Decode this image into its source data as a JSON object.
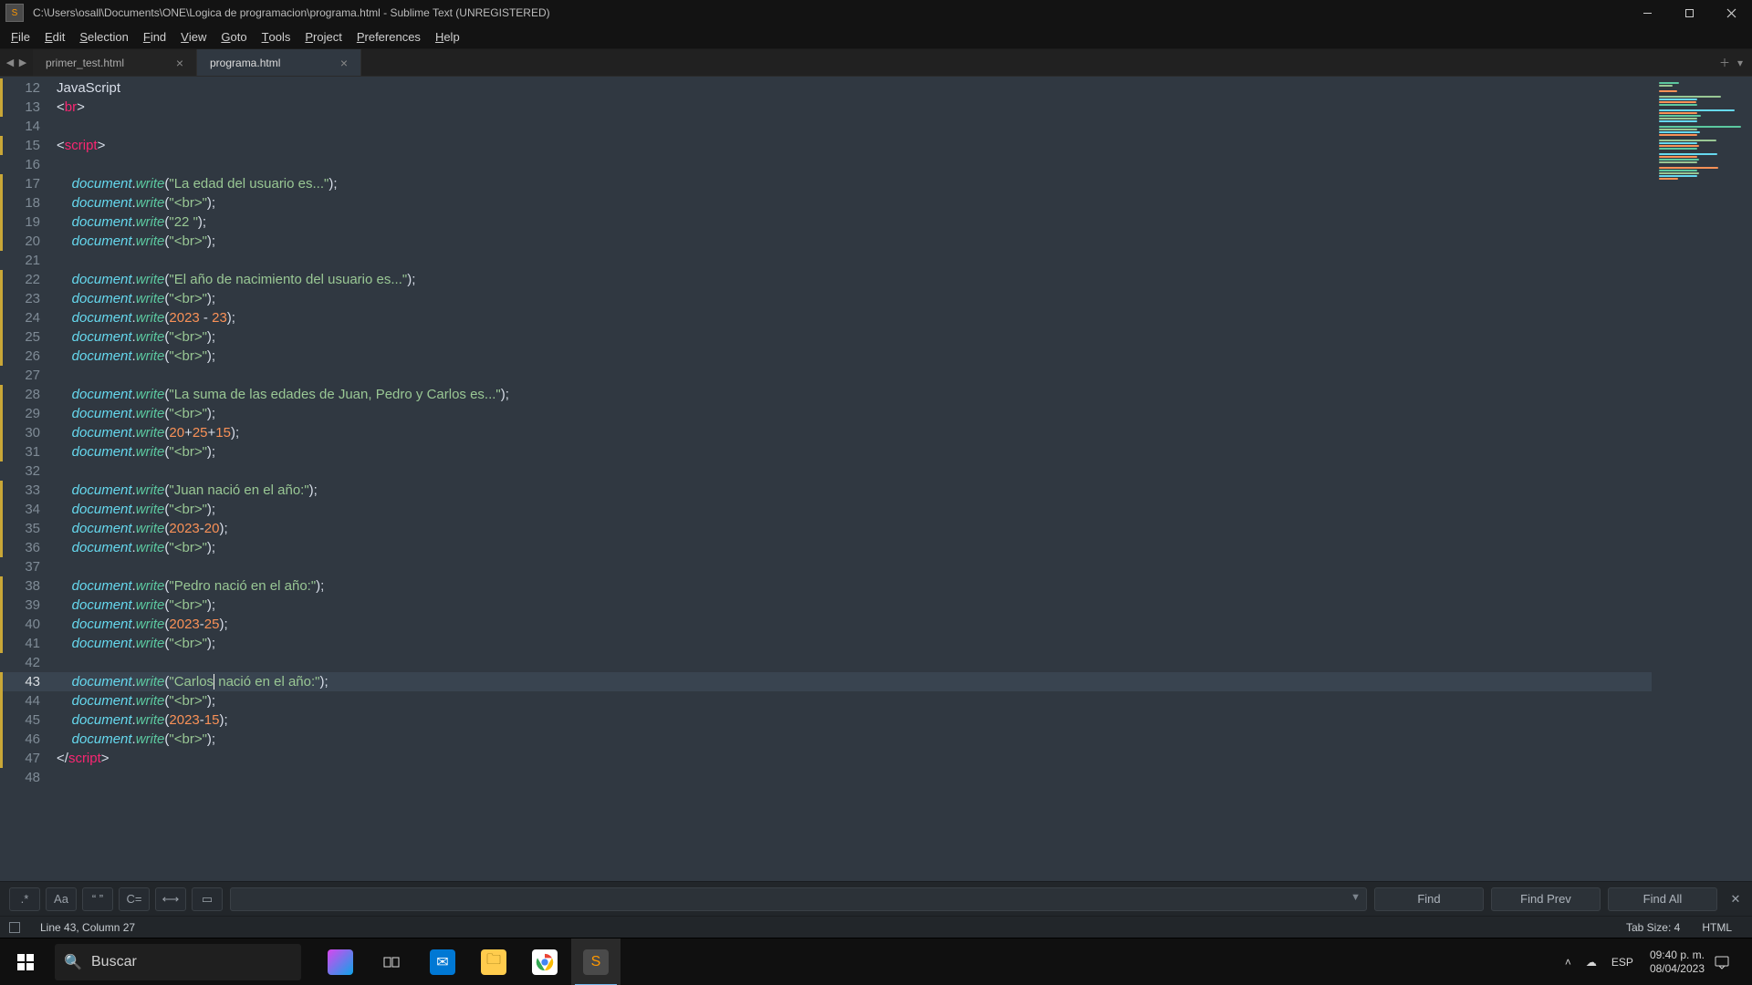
{
  "titlebar": {
    "path": "C:\\Users\\osall\\Documents\\ONE\\Logica de programacion\\programa.html - Sublime Text (UNREGISTERED)"
  },
  "menu": [
    "File",
    "Edit",
    "Selection",
    "Find",
    "View",
    "Goto",
    "Tools",
    "Project",
    "Preferences",
    "Help"
  ],
  "tabs": {
    "nav_back": "◀",
    "nav_fwd": "▶",
    "items": [
      {
        "label": "primer_test.html",
        "active": false
      },
      {
        "label": "programa.html",
        "active": true
      }
    ],
    "add": "＋",
    "more": "▾"
  },
  "editor": {
    "first_line_no": 12,
    "current_line_index": 31,
    "lines": [
      {
        "mod": true,
        "segs": [
          {
            "t": "plain",
            "v": "JavaScript"
          }
        ]
      },
      {
        "mod": true,
        "segs": [
          {
            "t": "punc",
            "v": "<"
          },
          {
            "t": "key",
            "v": "br"
          },
          {
            "t": "punc",
            "v": ">"
          }
        ]
      },
      {
        "mod": false,
        "segs": []
      },
      {
        "mod": true,
        "segs": [
          {
            "t": "punc",
            "v": "<"
          },
          {
            "t": "key",
            "v": "script"
          },
          {
            "t": "punc",
            "v": ">"
          }
        ]
      },
      {
        "mod": false,
        "segs": []
      },
      {
        "mod": true,
        "segs": [
          {
            "t": "plain",
            "v": "    "
          },
          {
            "t": "var",
            "v": "document"
          },
          {
            "t": "punc",
            "v": "."
          },
          {
            "t": "call",
            "v": "write"
          },
          {
            "t": "punc",
            "v": "("
          },
          {
            "t": "str",
            "v": "\"La edad del usuario es...\""
          },
          {
            "t": "punc",
            "v": ");"
          }
        ]
      },
      {
        "mod": true,
        "segs": [
          {
            "t": "plain",
            "v": "    "
          },
          {
            "t": "var",
            "v": "document"
          },
          {
            "t": "punc",
            "v": "."
          },
          {
            "t": "call",
            "v": "write"
          },
          {
            "t": "punc",
            "v": "("
          },
          {
            "t": "str",
            "v": "\"<br>\""
          },
          {
            "t": "punc",
            "v": ");"
          }
        ]
      },
      {
        "mod": true,
        "segs": [
          {
            "t": "plain",
            "v": "    "
          },
          {
            "t": "var",
            "v": "document"
          },
          {
            "t": "punc",
            "v": "."
          },
          {
            "t": "call",
            "v": "write"
          },
          {
            "t": "punc",
            "v": "("
          },
          {
            "t": "str",
            "v": "\"22 \""
          },
          {
            "t": "punc",
            "v": ");"
          }
        ]
      },
      {
        "mod": true,
        "segs": [
          {
            "t": "plain",
            "v": "    "
          },
          {
            "t": "var",
            "v": "document"
          },
          {
            "t": "punc",
            "v": "."
          },
          {
            "t": "call",
            "v": "write"
          },
          {
            "t": "punc",
            "v": "("
          },
          {
            "t": "str",
            "v": "\"<br>\""
          },
          {
            "t": "punc",
            "v": ");"
          }
        ]
      },
      {
        "mod": false,
        "segs": []
      },
      {
        "mod": true,
        "segs": [
          {
            "t": "plain",
            "v": "    "
          },
          {
            "t": "var",
            "v": "document"
          },
          {
            "t": "punc",
            "v": "."
          },
          {
            "t": "call",
            "v": "write"
          },
          {
            "t": "punc",
            "v": "("
          },
          {
            "t": "str",
            "v": "\"El año de nacimiento del usuario es...\""
          },
          {
            "t": "punc",
            "v": ");"
          }
        ]
      },
      {
        "mod": true,
        "segs": [
          {
            "t": "plain",
            "v": "    "
          },
          {
            "t": "var",
            "v": "document"
          },
          {
            "t": "punc",
            "v": "."
          },
          {
            "t": "call",
            "v": "write"
          },
          {
            "t": "punc",
            "v": "("
          },
          {
            "t": "str",
            "v": "\"<br>\""
          },
          {
            "t": "punc",
            "v": ");"
          }
        ]
      },
      {
        "mod": true,
        "segs": [
          {
            "t": "plain",
            "v": "    "
          },
          {
            "t": "var",
            "v": "document"
          },
          {
            "t": "punc",
            "v": "."
          },
          {
            "t": "call",
            "v": "write"
          },
          {
            "t": "punc",
            "v": "("
          },
          {
            "t": "num",
            "v": "2023"
          },
          {
            "t": "punc",
            "v": " - "
          },
          {
            "t": "num",
            "v": "23"
          },
          {
            "t": "punc",
            "v": ");"
          }
        ]
      },
      {
        "mod": true,
        "segs": [
          {
            "t": "plain",
            "v": "    "
          },
          {
            "t": "var",
            "v": "document"
          },
          {
            "t": "punc",
            "v": "."
          },
          {
            "t": "call",
            "v": "write"
          },
          {
            "t": "punc",
            "v": "("
          },
          {
            "t": "str",
            "v": "\"<br>\""
          },
          {
            "t": "punc",
            "v": ");"
          }
        ]
      },
      {
        "mod": true,
        "segs": [
          {
            "t": "plain",
            "v": "    "
          },
          {
            "t": "var",
            "v": "document"
          },
          {
            "t": "punc",
            "v": "."
          },
          {
            "t": "call",
            "v": "write"
          },
          {
            "t": "punc",
            "v": "("
          },
          {
            "t": "str",
            "v": "\"<br>\""
          },
          {
            "t": "punc",
            "v": ");"
          }
        ]
      },
      {
        "mod": false,
        "segs": []
      },
      {
        "mod": true,
        "segs": [
          {
            "t": "plain",
            "v": "    "
          },
          {
            "t": "var",
            "v": "document"
          },
          {
            "t": "punc",
            "v": "."
          },
          {
            "t": "call",
            "v": "write"
          },
          {
            "t": "punc",
            "v": "("
          },
          {
            "t": "str",
            "v": "\"La suma de las edades de Juan, Pedro y Carlos es...\""
          },
          {
            "t": "punc",
            "v": ");"
          }
        ]
      },
      {
        "mod": true,
        "segs": [
          {
            "t": "plain",
            "v": "    "
          },
          {
            "t": "var",
            "v": "document"
          },
          {
            "t": "punc",
            "v": "."
          },
          {
            "t": "call",
            "v": "write"
          },
          {
            "t": "punc",
            "v": "("
          },
          {
            "t": "str",
            "v": "\"<br>\""
          },
          {
            "t": "punc",
            "v": ");"
          }
        ]
      },
      {
        "mod": true,
        "segs": [
          {
            "t": "plain",
            "v": "    "
          },
          {
            "t": "var",
            "v": "document"
          },
          {
            "t": "punc",
            "v": "."
          },
          {
            "t": "call",
            "v": "write"
          },
          {
            "t": "punc",
            "v": "("
          },
          {
            "t": "num",
            "v": "20"
          },
          {
            "t": "punc",
            "v": "+"
          },
          {
            "t": "num",
            "v": "25"
          },
          {
            "t": "punc",
            "v": "+"
          },
          {
            "t": "num",
            "v": "15"
          },
          {
            "t": "punc",
            "v": ");"
          }
        ]
      },
      {
        "mod": true,
        "segs": [
          {
            "t": "plain",
            "v": "    "
          },
          {
            "t": "var",
            "v": "document"
          },
          {
            "t": "punc",
            "v": "."
          },
          {
            "t": "call",
            "v": "write"
          },
          {
            "t": "punc",
            "v": "("
          },
          {
            "t": "str",
            "v": "\"<br>\""
          },
          {
            "t": "punc",
            "v": ");"
          }
        ]
      },
      {
        "mod": false,
        "segs": []
      },
      {
        "mod": true,
        "segs": [
          {
            "t": "plain",
            "v": "    "
          },
          {
            "t": "var",
            "v": "document"
          },
          {
            "t": "punc",
            "v": "."
          },
          {
            "t": "call",
            "v": "write"
          },
          {
            "t": "punc",
            "v": "("
          },
          {
            "t": "str",
            "v": "\"Juan nació en el año:\""
          },
          {
            "t": "punc",
            "v": ");"
          }
        ]
      },
      {
        "mod": true,
        "segs": [
          {
            "t": "plain",
            "v": "    "
          },
          {
            "t": "var",
            "v": "document"
          },
          {
            "t": "punc",
            "v": "."
          },
          {
            "t": "call",
            "v": "write"
          },
          {
            "t": "punc",
            "v": "("
          },
          {
            "t": "str",
            "v": "\"<br>\""
          },
          {
            "t": "punc",
            "v": ");"
          }
        ]
      },
      {
        "mod": true,
        "segs": [
          {
            "t": "plain",
            "v": "    "
          },
          {
            "t": "var",
            "v": "document"
          },
          {
            "t": "punc",
            "v": "."
          },
          {
            "t": "call",
            "v": "write"
          },
          {
            "t": "punc",
            "v": "("
          },
          {
            "t": "num",
            "v": "2023"
          },
          {
            "t": "punc",
            "v": "-"
          },
          {
            "t": "num",
            "v": "20"
          },
          {
            "t": "punc",
            "v": ");"
          }
        ]
      },
      {
        "mod": true,
        "segs": [
          {
            "t": "plain",
            "v": "    "
          },
          {
            "t": "var",
            "v": "document"
          },
          {
            "t": "punc",
            "v": "."
          },
          {
            "t": "call",
            "v": "write"
          },
          {
            "t": "punc",
            "v": "("
          },
          {
            "t": "str",
            "v": "\"<br>\""
          },
          {
            "t": "punc",
            "v": ");"
          }
        ]
      },
      {
        "mod": false,
        "segs": []
      },
      {
        "mod": true,
        "segs": [
          {
            "t": "plain",
            "v": "    "
          },
          {
            "t": "var",
            "v": "document"
          },
          {
            "t": "punc",
            "v": "."
          },
          {
            "t": "call",
            "v": "write"
          },
          {
            "t": "punc",
            "v": "("
          },
          {
            "t": "str",
            "v": "\"Pedro nació en el año:\""
          },
          {
            "t": "punc",
            "v": ");"
          }
        ]
      },
      {
        "mod": true,
        "segs": [
          {
            "t": "plain",
            "v": "    "
          },
          {
            "t": "var",
            "v": "document"
          },
          {
            "t": "punc",
            "v": "."
          },
          {
            "t": "call",
            "v": "write"
          },
          {
            "t": "punc",
            "v": "("
          },
          {
            "t": "str",
            "v": "\"<br>\""
          },
          {
            "t": "punc",
            "v": ");"
          }
        ]
      },
      {
        "mod": true,
        "segs": [
          {
            "t": "plain",
            "v": "    "
          },
          {
            "t": "var",
            "v": "document"
          },
          {
            "t": "punc",
            "v": "."
          },
          {
            "t": "call",
            "v": "write"
          },
          {
            "t": "punc",
            "v": "("
          },
          {
            "t": "num",
            "v": "2023"
          },
          {
            "t": "punc",
            "v": "-"
          },
          {
            "t": "num",
            "v": "25"
          },
          {
            "t": "punc",
            "v": ");"
          }
        ]
      },
      {
        "mod": true,
        "segs": [
          {
            "t": "plain",
            "v": "    "
          },
          {
            "t": "var",
            "v": "document"
          },
          {
            "t": "punc",
            "v": "."
          },
          {
            "t": "call",
            "v": "write"
          },
          {
            "t": "punc",
            "v": "("
          },
          {
            "t": "str",
            "v": "\"<br>\""
          },
          {
            "t": "punc",
            "v": ");"
          }
        ]
      },
      {
        "mod": false,
        "segs": []
      },
      {
        "mod": true,
        "cursor_after": 1,
        "segs": [
          {
            "t": "plain",
            "v": "    "
          },
          {
            "t": "var",
            "v": "document"
          },
          {
            "t": "punc",
            "v": "."
          },
          {
            "t": "call",
            "v": "write"
          },
          {
            "t": "punc",
            "v": "("
          },
          {
            "t": "str",
            "v": "\"Carlos"
          },
          {
            "t": "cursor",
            "v": ""
          },
          {
            "t": "str",
            "v": " nació en el año:\""
          },
          {
            "t": "punc",
            "v": ");"
          }
        ]
      },
      {
        "mod": true,
        "segs": [
          {
            "t": "plain",
            "v": "    "
          },
          {
            "t": "var",
            "v": "document"
          },
          {
            "t": "punc",
            "v": "."
          },
          {
            "t": "call",
            "v": "write"
          },
          {
            "t": "punc",
            "v": "("
          },
          {
            "t": "str",
            "v": "\"<br>\""
          },
          {
            "t": "punc",
            "v": ");"
          }
        ]
      },
      {
        "mod": true,
        "segs": [
          {
            "t": "plain",
            "v": "    "
          },
          {
            "t": "var",
            "v": "document"
          },
          {
            "t": "punc",
            "v": "."
          },
          {
            "t": "call",
            "v": "write"
          },
          {
            "t": "punc",
            "v": "("
          },
          {
            "t": "num",
            "v": "2023"
          },
          {
            "t": "punc",
            "v": "-"
          },
          {
            "t": "num",
            "v": "15"
          },
          {
            "t": "punc",
            "v": ");"
          }
        ]
      },
      {
        "mod": true,
        "segs": [
          {
            "t": "plain",
            "v": "    "
          },
          {
            "t": "var",
            "v": "document"
          },
          {
            "t": "punc",
            "v": "."
          },
          {
            "t": "call",
            "v": "write"
          },
          {
            "t": "punc",
            "v": "("
          },
          {
            "t": "str",
            "v": "\"<br>\""
          },
          {
            "t": "punc",
            "v": ");"
          }
        ]
      },
      {
        "mod": true,
        "segs": [
          {
            "t": "punc",
            "v": "</"
          },
          {
            "t": "key",
            "v": "script"
          },
          {
            "t": "punc",
            "v": ">"
          }
        ]
      },
      {
        "mod": false,
        "segs": []
      }
    ]
  },
  "findbar": {
    "options": [
      ".*",
      "Aa",
      "“ ”",
      "C=",
      "⟷",
      "▭"
    ],
    "find": "Find",
    "find_prev": "Find Prev",
    "find_all": "Find All"
  },
  "statusbar": {
    "position": "Line 43, Column 27",
    "tab_size": "Tab Size: 4",
    "syntax": "HTML"
  },
  "taskbar": {
    "search_placeholder": "Buscar",
    "time": "09:40 p. m.",
    "date": "08/04/2023"
  }
}
